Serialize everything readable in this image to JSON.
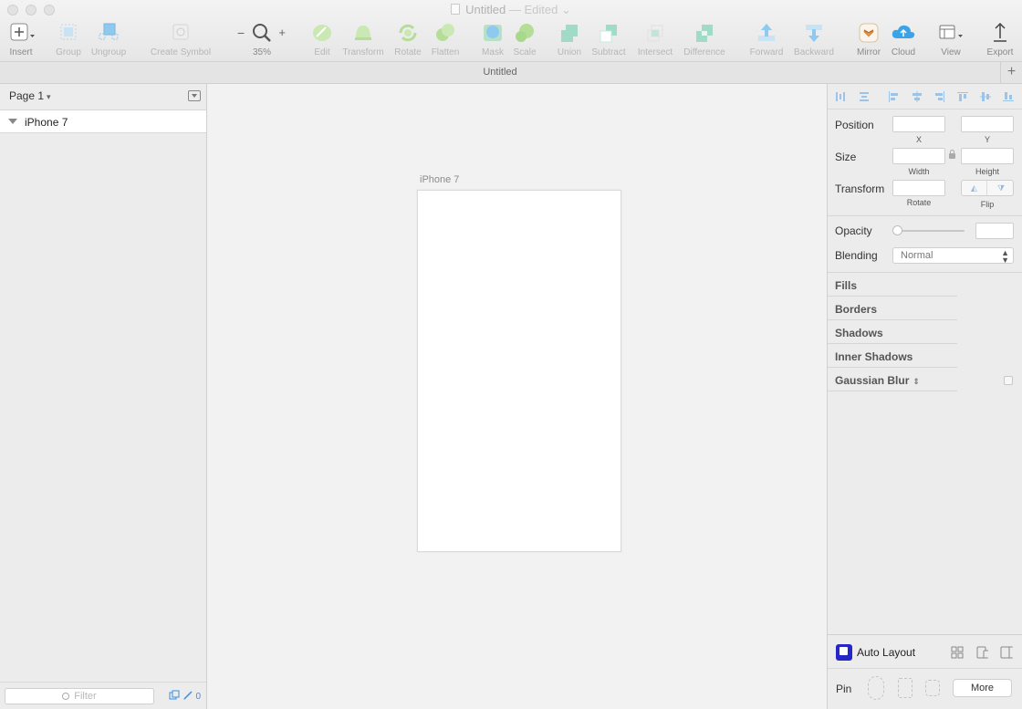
{
  "window": {
    "title": "Untitled",
    "title_suffix": "— Edited",
    "title_chevron": "⌄"
  },
  "toolbar": {
    "insert": "Insert",
    "group": "Group",
    "ungroup": "Ungroup",
    "create_symbol": "Create Symbol",
    "zoom_out": "−",
    "zoom_in": "+",
    "zoom_level": "35%",
    "edit": "Edit",
    "transform": "Transform",
    "rotate": "Rotate",
    "flatten": "Flatten",
    "mask": "Mask",
    "scale": "Scale",
    "union": "Union",
    "subtract": "Subtract",
    "intersect": "Intersect",
    "difference": "Difference",
    "forward": "Forward",
    "backward": "Backward",
    "mirror": "Mirror",
    "cloud": "Cloud",
    "view": "View",
    "export": "Export"
  },
  "tabbar": {
    "title": "Untitled",
    "add": "+"
  },
  "sidebar": {
    "page_label": "Page 1",
    "layers": [
      {
        "name": "iPhone 7"
      }
    ],
    "filter_placeholder": "Filter",
    "slice_count": "0"
  },
  "canvas": {
    "artboard_name": "iPhone 7"
  },
  "inspector": {
    "position_label": "Position",
    "x_label": "X",
    "y_label": "Y",
    "size_label": "Size",
    "width_label": "Width",
    "height_label": "Height",
    "transform_label": "Transform",
    "rotate_label": "Rotate",
    "flip_label": "Flip",
    "opacity_label": "Opacity",
    "opacity_value": 0,
    "blending_label": "Blending",
    "blending_value": "Normal",
    "sections": [
      "Fills",
      "Borders",
      "Shadows",
      "Inner Shadows"
    ],
    "gaussian_blur": "Gaussian Blur",
    "auto_layout": "Auto Layout",
    "pin_label": "Pin",
    "more_label": "More"
  },
  "colors": {
    "accent": "#3a8ee6",
    "auto_layout_brand": "#2727c9",
    "toolbar_icon_green": "#a7d98a",
    "toolbar_icon_blue": "#8ec9ef"
  }
}
